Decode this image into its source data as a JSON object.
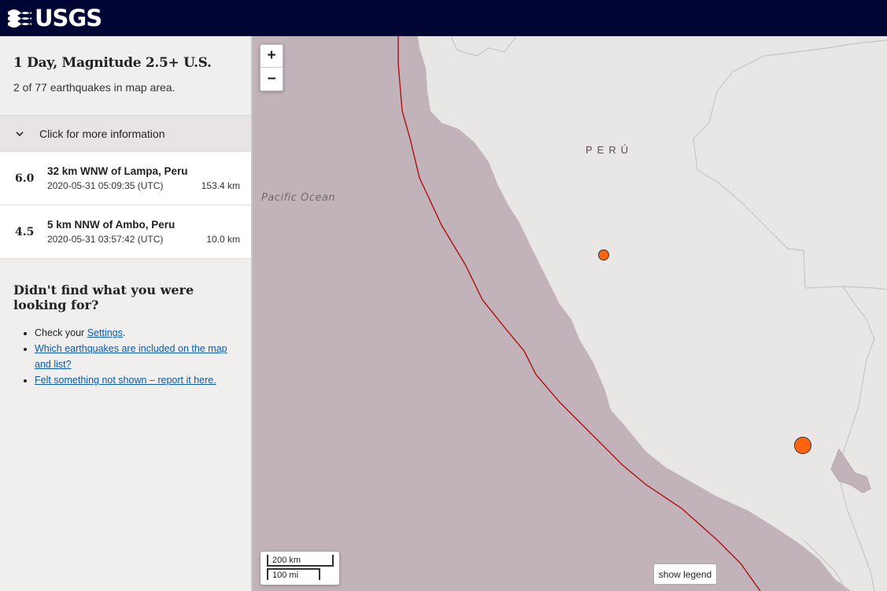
{
  "header": {
    "logo_text": "USGS"
  },
  "sidebar": {
    "title": "1 Day, Magnitude 2.5+ U.S.",
    "count_text": "2 of 77 earthquakes in map area.",
    "more_info_label": "Click for more information",
    "earthquakes": [
      {
        "mag": "6.0",
        "place": "32 km WNW of Lampa, Peru",
        "time": "2020-05-31 05:09:35 (UTC)",
        "depth": "153.4 km"
      },
      {
        "mag": "4.5",
        "place": "5 km NNW of Ambo, Peru",
        "time": "2020-05-31 03:57:42 (UTC)",
        "depth": "10.0 km"
      }
    ],
    "help": {
      "title": "Didn't find what you were looking for?",
      "item1_prefix": "Check your ",
      "item1_link": "Settings",
      "item1_suffix": ".",
      "item2_link": "Which earthquakes are included on the map and list?",
      "item3_link": "Felt something not shown – report it here."
    }
  },
  "map": {
    "zoom_in": "+",
    "zoom_out": "−",
    "ocean_label": "Pacific Ocean",
    "country_label": "PERÚ",
    "scale_km": "200 km",
    "scale_mi": "100 mi",
    "legend_button": "show legend",
    "colors": {
      "ocean": "#c2b3ba",
      "land": "#e9e6e6",
      "plate_boundary": "#b01010",
      "quake": "#ff6411"
    }
  }
}
